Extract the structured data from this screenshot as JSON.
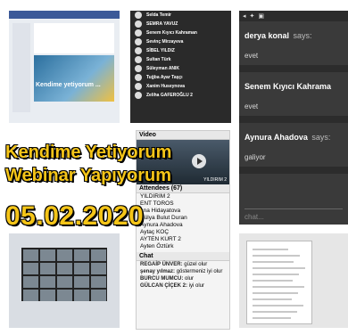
{
  "overlay": {
    "line1": "Kendime Yetiyorum",
    "line2": "Webinar Yapıyorum",
    "date": "05.02.2020"
  },
  "participants": [
    "Selda Temir",
    "SEMRA YAVUZ",
    "Senem Kıyıcı Kahraman",
    "Sevinç Mirzayeva",
    "SİBEL YILDIZ",
    "Sultan Türk",
    "Süleyman ANIK",
    "Tuğba Ayar Taşçı",
    "Xanim Huseynova",
    "Zeliha GAFEROĞLU 2"
  ],
  "comments": [
    {
      "name": "derya konal",
      "says": "says:",
      "msg": "evet"
    },
    {
      "name": "Senem Kıyıcı Kahrama",
      "says": "",
      "msg": "evet"
    },
    {
      "name": "Aynura Ahadova",
      "says": "says:",
      "msg": "galiyor"
    }
  ],
  "chat_placeholder": "chat...",
  "middle": {
    "video_header": "Video",
    "video_caption": "YILDIRIM 2",
    "attendees_header": "Attendees (67)",
    "attendees": [
      "YILDIRIM 2",
      "ENT TOROS",
      "ana Hidayatova",
      "Hülya Bulut Duran",
      "Aynura Ahadova",
      "Aytaç KOÇ",
      "AYTEN KURT 2",
      "Ayten Öztürk"
    ],
    "chat_header": "Chat",
    "chat": [
      {
        "name": "REGAİP ÜNVER:",
        "text": "güzel olur"
      },
      {
        "name": "şenay yılmaz:",
        "text": "göstermeniz iyi olur"
      },
      {
        "name": "BURCU MUMCU:",
        "text": "olur"
      },
      {
        "name": "GÜLCAN  ÇİÇEK 2:",
        "text": "iyi olur"
      }
    ]
  },
  "topleft_caption": "Kendime yetiyorum ..."
}
